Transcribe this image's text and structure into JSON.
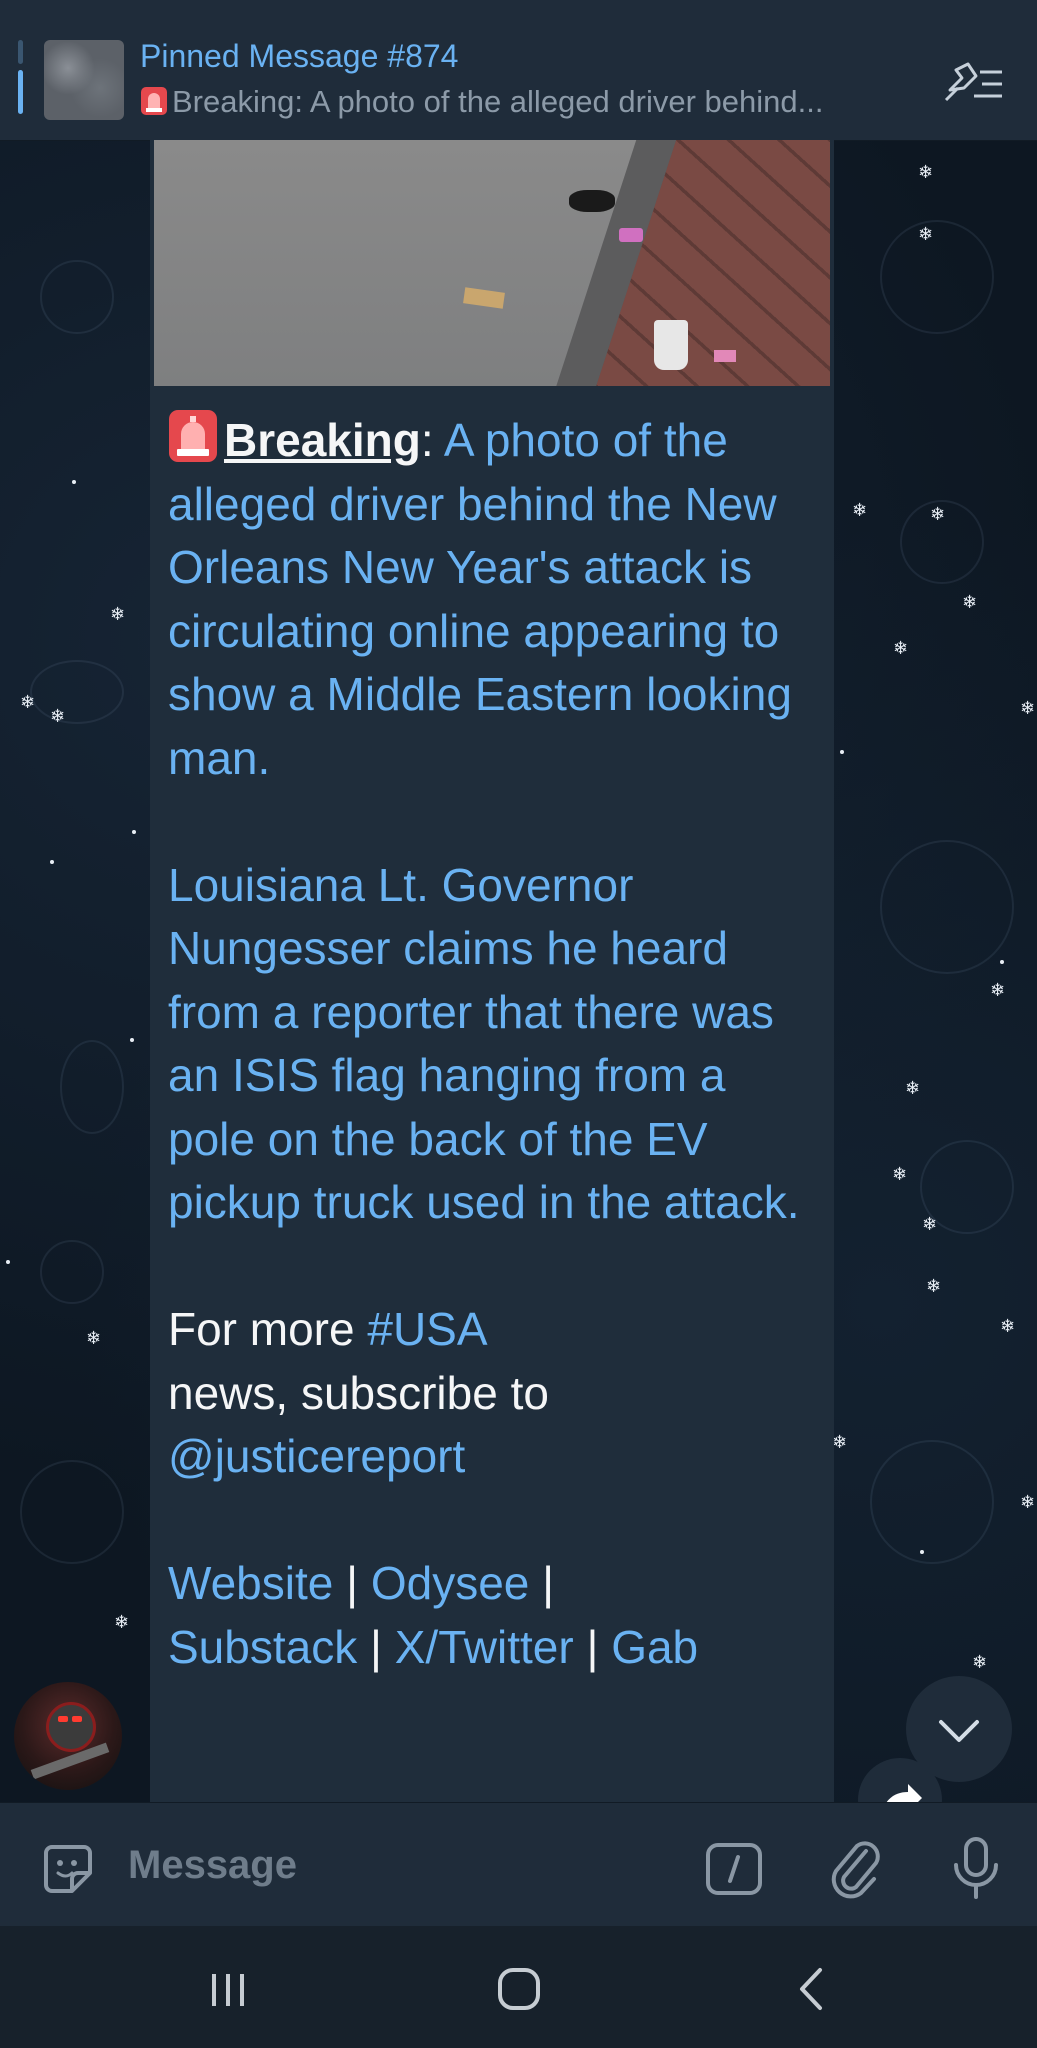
{
  "pinned": {
    "title": "Pinned Message #874",
    "preview": "Breaking: A photo of the alleged driver behind..."
  },
  "message": {
    "breaking_label": "Breaking",
    "colon": ":",
    "paragraph1": "A photo of the alleged driver behind the New Orleans New Year's attack is circulating online appearing to show a Middle Eastern looking man.",
    "paragraph2": "Louisiana Lt. Governor Nungesser claims he heard from a reporter that there was an ISIS flag hanging from a pole on the back of the EV pickup truck used in the attack.",
    "promo_prefix": "For more ",
    "promo_hashtag": "#USA",
    "promo_middle": " news, subscribe to ",
    "promo_handle": "@justicereport",
    "links": [
      "Website",
      "Odysee",
      "Substack",
      "X/Twitter",
      "Gab"
    ],
    "separator": " | "
  },
  "input": {
    "placeholder": "Message"
  },
  "colors": {
    "accent": "#6ab2f2",
    "background": "#0e1621",
    "bubble": "#1f2d3b",
    "bar": "#1f2c3a"
  },
  "icons": [
    "pin-list-icon",
    "sticker-icon",
    "bot-command-icon",
    "attach-icon",
    "microphone-icon",
    "chevron-down-icon",
    "share-icon",
    "recent-apps-icon",
    "home-icon",
    "back-icon"
  ]
}
